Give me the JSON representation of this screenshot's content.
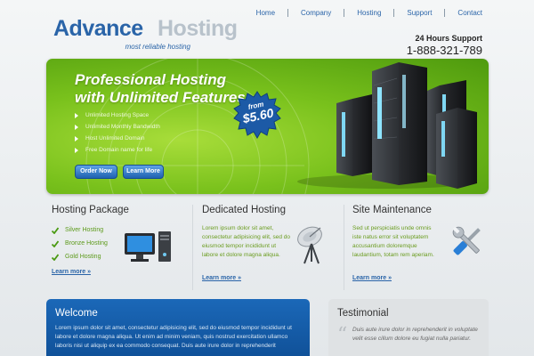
{
  "logo": {
    "word1": "Advance",
    "word2": "Hosting",
    "tagline": "most reliable hosting"
  },
  "nav": {
    "items": [
      "Home",
      "Company",
      "Hosting",
      "Support",
      "Contact"
    ]
  },
  "support": {
    "label": "24 Hours Support",
    "phone": "1-888-321-789"
  },
  "banner": {
    "title_line1": "Professional Hosting",
    "title_line2": "with Unlimited Features",
    "features": [
      "Unlimited Hosting Space",
      "Unlimited Monthly Bandwidth",
      "Host Unlimited Domain",
      "Free Domain name for life"
    ],
    "order_button": "Order Now",
    "learn_button": "Learn More",
    "price_from": "from",
    "price_amount": "$5.60"
  },
  "columns": {
    "package": {
      "title": "Hosting Package",
      "items": [
        "Silver Hosting",
        "Bronze Hosting",
        "Gold Hosting"
      ],
      "link": "Learn more »"
    },
    "dedicated": {
      "title": "Dedicated Hosting",
      "text": "Lorem ipsum dolor sit amet, consectetur adipisicing elit, sed do eiusmod tempor incididunt ut labore et dolore magna aliqua.",
      "link": "Learn more »"
    },
    "maintenance": {
      "title": "Site Maintenance",
      "text": "Sed ut perspiciatis unde omnis iste natus error sit voluptatem accusantium doloremque laudantium, totam rem aperiam.",
      "link": "Learn more »"
    }
  },
  "welcome": {
    "title": "Welcome",
    "text": "Lorem ipsum dolor sit amet, consectetur adipisicing elit, sed do eiusmod tempor incididunt ut labore et dolore magna aliqua. Ut enim ad minim veniam, quis nostrud exercitation ullamco laboris nisi ut aliquip ex ea commodo consequat. Duis aute irure dolor in reprehenderit"
  },
  "testimonial": {
    "title": "Testimonial",
    "text": "Duis aute irure dolor in reprehenderit in voluptate velit esse cillum dolore eu fugiat nulla pariatur."
  },
  "colors": {
    "brand_blue": "#2a64a8",
    "banner_green": "#79c11c",
    "text_green": "#6a9c1f"
  }
}
